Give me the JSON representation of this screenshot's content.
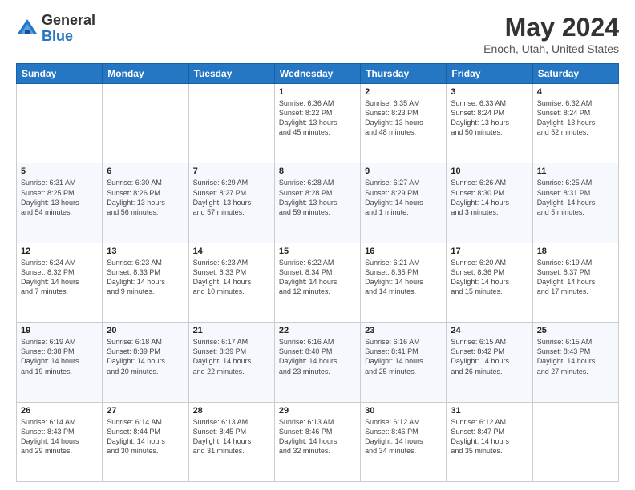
{
  "header": {
    "logo_general": "General",
    "logo_blue": "Blue",
    "title": "May 2024",
    "subtitle": "Enoch, Utah, United States"
  },
  "days_of_week": [
    "Sunday",
    "Monday",
    "Tuesday",
    "Wednesday",
    "Thursday",
    "Friday",
    "Saturday"
  ],
  "weeks": [
    [
      {
        "day": "",
        "info": ""
      },
      {
        "day": "",
        "info": ""
      },
      {
        "day": "",
        "info": ""
      },
      {
        "day": "1",
        "info": "Sunrise: 6:36 AM\nSunset: 8:22 PM\nDaylight: 13 hours\nand 45 minutes."
      },
      {
        "day": "2",
        "info": "Sunrise: 6:35 AM\nSunset: 8:23 PM\nDaylight: 13 hours\nand 48 minutes."
      },
      {
        "day": "3",
        "info": "Sunrise: 6:33 AM\nSunset: 8:24 PM\nDaylight: 13 hours\nand 50 minutes."
      },
      {
        "day": "4",
        "info": "Sunrise: 6:32 AM\nSunset: 8:24 PM\nDaylight: 13 hours\nand 52 minutes."
      }
    ],
    [
      {
        "day": "5",
        "info": "Sunrise: 6:31 AM\nSunset: 8:25 PM\nDaylight: 13 hours\nand 54 minutes."
      },
      {
        "day": "6",
        "info": "Sunrise: 6:30 AM\nSunset: 8:26 PM\nDaylight: 13 hours\nand 56 minutes."
      },
      {
        "day": "7",
        "info": "Sunrise: 6:29 AM\nSunset: 8:27 PM\nDaylight: 13 hours\nand 57 minutes."
      },
      {
        "day": "8",
        "info": "Sunrise: 6:28 AM\nSunset: 8:28 PM\nDaylight: 13 hours\nand 59 minutes."
      },
      {
        "day": "9",
        "info": "Sunrise: 6:27 AM\nSunset: 8:29 PM\nDaylight: 14 hours\nand 1 minute."
      },
      {
        "day": "10",
        "info": "Sunrise: 6:26 AM\nSunset: 8:30 PM\nDaylight: 14 hours\nand 3 minutes."
      },
      {
        "day": "11",
        "info": "Sunrise: 6:25 AM\nSunset: 8:31 PM\nDaylight: 14 hours\nand 5 minutes."
      }
    ],
    [
      {
        "day": "12",
        "info": "Sunrise: 6:24 AM\nSunset: 8:32 PM\nDaylight: 14 hours\nand 7 minutes."
      },
      {
        "day": "13",
        "info": "Sunrise: 6:23 AM\nSunset: 8:33 PM\nDaylight: 14 hours\nand 9 minutes."
      },
      {
        "day": "14",
        "info": "Sunrise: 6:23 AM\nSunset: 8:33 PM\nDaylight: 14 hours\nand 10 minutes."
      },
      {
        "day": "15",
        "info": "Sunrise: 6:22 AM\nSunset: 8:34 PM\nDaylight: 14 hours\nand 12 minutes."
      },
      {
        "day": "16",
        "info": "Sunrise: 6:21 AM\nSunset: 8:35 PM\nDaylight: 14 hours\nand 14 minutes."
      },
      {
        "day": "17",
        "info": "Sunrise: 6:20 AM\nSunset: 8:36 PM\nDaylight: 14 hours\nand 15 minutes."
      },
      {
        "day": "18",
        "info": "Sunrise: 6:19 AM\nSunset: 8:37 PM\nDaylight: 14 hours\nand 17 minutes."
      }
    ],
    [
      {
        "day": "19",
        "info": "Sunrise: 6:19 AM\nSunset: 8:38 PM\nDaylight: 14 hours\nand 19 minutes."
      },
      {
        "day": "20",
        "info": "Sunrise: 6:18 AM\nSunset: 8:39 PM\nDaylight: 14 hours\nand 20 minutes."
      },
      {
        "day": "21",
        "info": "Sunrise: 6:17 AM\nSunset: 8:39 PM\nDaylight: 14 hours\nand 22 minutes."
      },
      {
        "day": "22",
        "info": "Sunrise: 6:16 AM\nSunset: 8:40 PM\nDaylight: 14 hours\nand 23 minutes."
      },
      {
        "day": "23",
        "info": "Sunrise: 6:16 AM\nSunset: 8:41 PM\nDaylight: 14 hours\nand 25 minutes."
      },
      {
        "day": "24",
        "info": "Sunrise: 6:15 AM\nSunset: 8:42 PM\nDaylight: 14 hours\nand 26 minutes."
      },
      {
        "day": "25",
        "info": "Sunrise: 6:15 AM\nSunset: 8:43 PM\nDaylight: 14 hours\nand 27 minutes."
      }
    ],
    [
      {
        "day": "26",
        "info": "Sunrise: 6:14 AM\nSunset: 8:43 PM\nDaylight: 14 hours\nand 29 minutes."
      },
      {
        "day": "27",
        "info": "Sunrise: 6:14 AM\nSunset: 8:44 PM\nDaylight: 14 hours\nand 30 minutes."
      },
      {
        "day": "28",
        "info": "Sunrise: 6:13 AM\nSunset: 8:45 PM\nDaylight: 14 hours\nand 31 minutes."
      },
      {
        "day": "29",
        "info": "Sunrise: 6:13 AM\nSunset: 8:46 PM\nDaylight: 14 hours\nand 32 minutes."
      },
      {
        "day": "30",
        "info": "Sunrise: 6:12 AM\nSunset: 8:46 PM\nDaylight: 14 hours\nand 34 minutes."
      },
      {
        "day": "31",
        "info": "Sunrise: 6:12 AM\nSunset: 8:47 PM\nDaylight: 14 hours\nand 35 minutes."
      },
      {
        "day": "",
        "info": ""
      }
    ]
  ]
}
